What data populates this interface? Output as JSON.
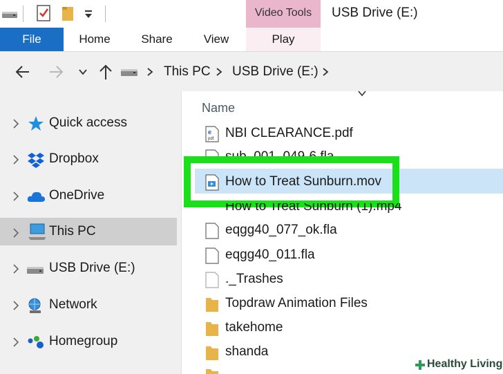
{
  "window": {
    "context_tab": "Video Tools",
    "title": "USB Drive (E:)"
  },
  "ribbon": {
    "tabs": [
      "File",
      "Home",
      "Share",
      "View",
      "Play"
    ]
  },
  "address": {
    "crumbs": [
      "This PC",
      "USB Drive (E:)"
    ]
  },
  "nav": {
    "items": [
      {
        "label": "Quick access",
        "icon": "star-icon"
      },
      {
        "label": "Dropbox",
        "icon": "dropbox-icon"
      },
      {
        "label": "OneDrive",
        "icon": "cloud-icon"
      },
      {
        "label": "This PC",
        "icon": "computer-icon",
        "selected": true
      },
      {
        "label": "USB Drive (E:)",
        "icon": "drive-icon"
      },
      {
        "label": "Network",
        "icon": "network-icon"
      },
      {
        "label": "Homegroup",
        "icon": "homegroup-icon"
      }
    ]
  },
  "files": {
    "column_header": "Name",
    "items": [
      {
        "name": "NBI CLEARANCE.pdf",
        "icon": "pdf-icon"
      },
      {
        "name": "sub_001_049-6.fla",
        "icon": "file-icon"
      },
      {
        "name": "How to Treat Sunburn.mov",
        "icon": "video-file-icon",
        "selected": true
      },
      {
        "name": "How to Treat Sunburn (1).mp4",
        "icon": "file-icon"
      },
      {
        "name": "eqgg40_077_ok.fla",
        "icon": "file-icon"
      },
      {
        "name": "eqgg40_011.fla",
        "icon": "file-icon"
      },
      {
        "name": "._Trashes",
        "icon": "file-icon"
      },
      {
        "name": "Topdraw Animation Files",
        "icon": "folder-icon"
      },
      {
        "name": "takehome",
        "icon": "folder-icon"
      },
      {
        "name": "shanda",
        "icon": "folder-icon"
      }
    ]
  },
  "watermark": {
    "text": "Healthy Living"
  },
  "colors": {
    "file_tab": "#1a6fc4",
    "video_tools": "#e9b6cb",
    "highlight": "#1bdf1b",
    "selection": "#cce4f7"
  }
}
